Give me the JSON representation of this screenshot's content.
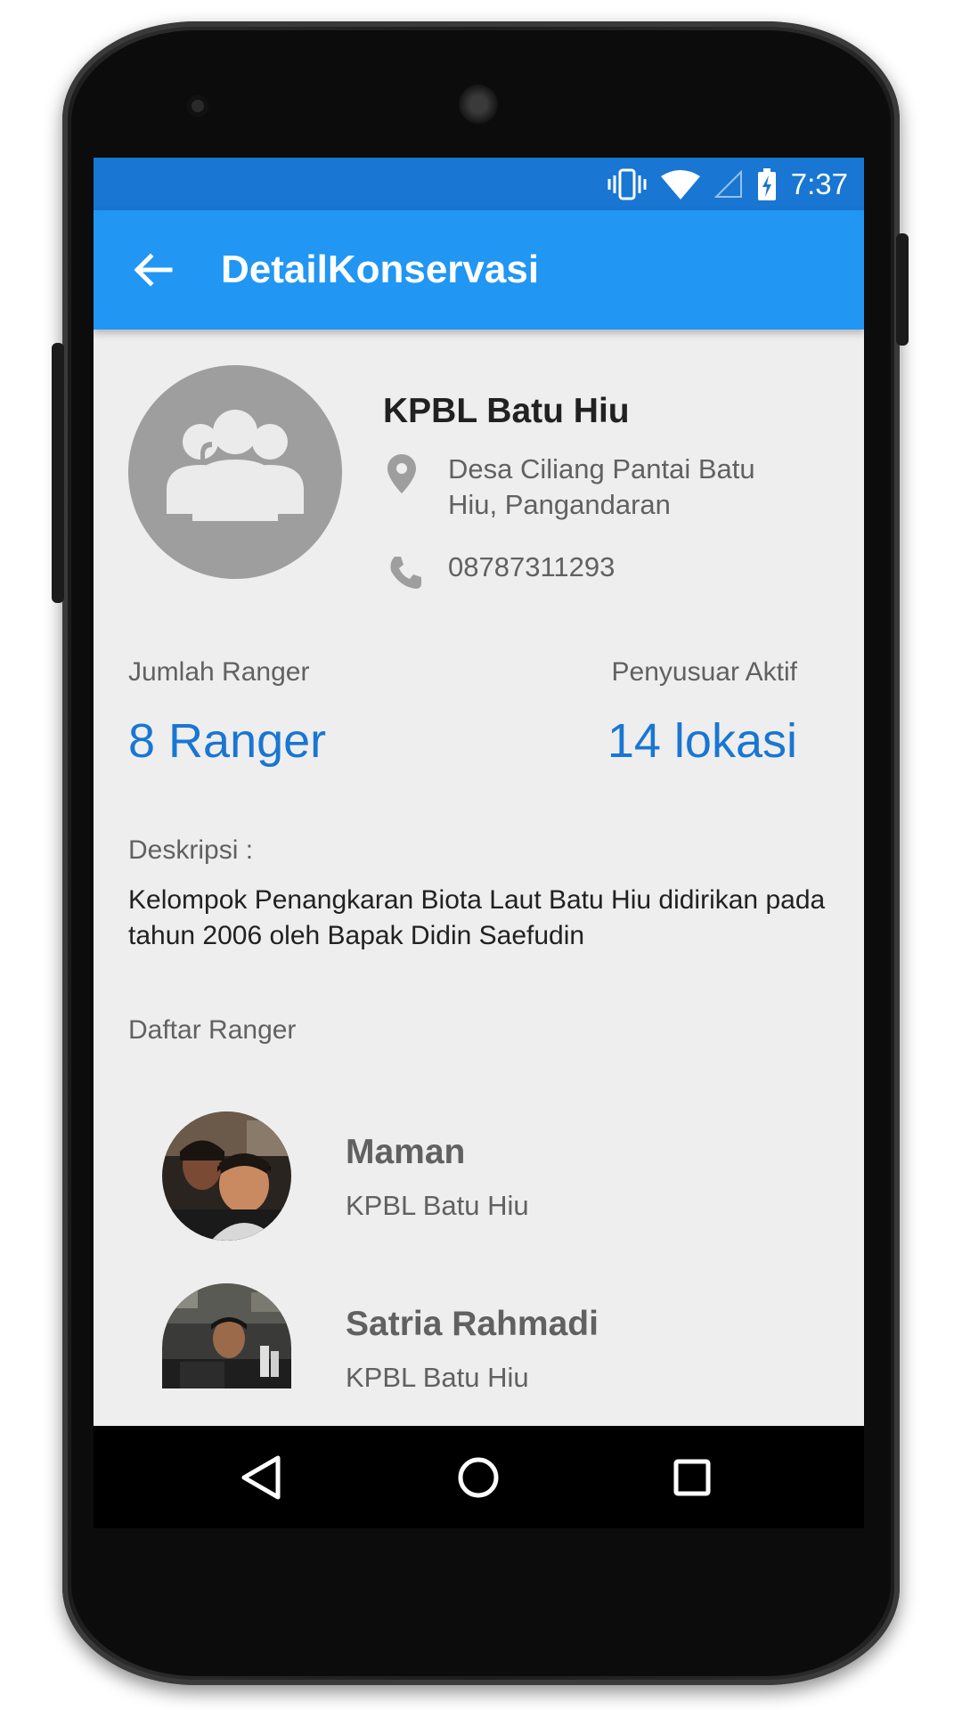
{
  "status_bar": {
    "time": "7:37",
    "icons": [
      "vibrate-icon",
      "wifi-icon",
      "cell-signal-icon",
      "battery-charging-icon"
    ]
  },
  "app_bar": {
    "title": "DetailKonservasi",
    "back_icon": "arrow-back-icon"
  },
  "group": {
    "avatar_icon": "group-icon",
    "name": "KPBL Batu Hiu",
    "address": "Desa Ciliang Pantai Batu Hiu, Pangandaran",
    "phone": "08787311293"
  },
  "stats": {
    "ranger_label": "Jumlah Ranger",
    "ranger_value": "8 Ranger",
    "location_label": "Penyusuar Aktif",
    "location_value": "14 lokasi"
  },
  "description": {
    "label": "Deskripsi :",
    "text": "Kelompok Penangkaran Biota Laut Batu Hiu didirikan pada tahun 2006 oleh Bapak Didin Saefudin"
  },
  "rangers": {
    "label": "Daftar Ranger",
    "items": [
      {
        "name": "Maman",
        "org": "KPBL Batu Hiu"
      },
      {
        "name": "Satria Rahmadi",
        "org": "KPBL Batu Hiu"
      }
    ]
  },
  "nav_bar": {
    "icons": [
      "nav-back-icon",
      "nav-home-icon",
      "nav-recents-icon"
    ]
  },
  "colors": {
    "status_bar": "#1976d2",
    "app_bar": "#2196f3",
    "accent_text": "#1976d2",
    "screen_bg": "#eeeeee"
  }
}
